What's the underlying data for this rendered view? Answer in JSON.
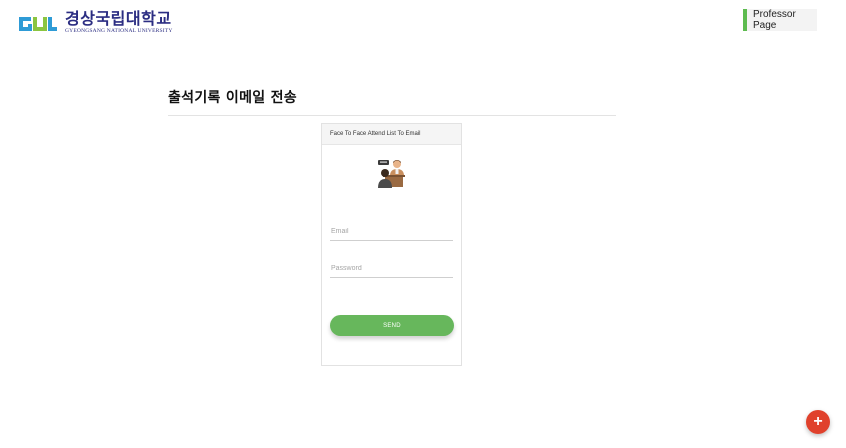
{
  "header": {
    "logo_korean": "경상국립대학교",
    "logo_english": "GYEONGSANG NATIONAL UNIVERSITY",
    "logo_icon": "gnu-logo-mark",
    "professor_page_label": "Professor Page",
    "accent_color": "#5dbb4f"
  },
  "main": {
    "page_title": "출석기록 이메일 전송"
  },
  "card": {
    "header_title": "Face To Face Attend List To Email",
    "illustration_icon": "face-to-face-meeting-icon",
    "email_placeholder": "Email",
    "email_value": "",
    "password_placeholder": "Password",
    "password_value": "",
    "send_label": "SEND",
    "button_color": "#67b75c"
  },
  "fab": {
    "icon": "plus-icon",
    "label": "+",
    "color": "#e0412c"
  }
}
